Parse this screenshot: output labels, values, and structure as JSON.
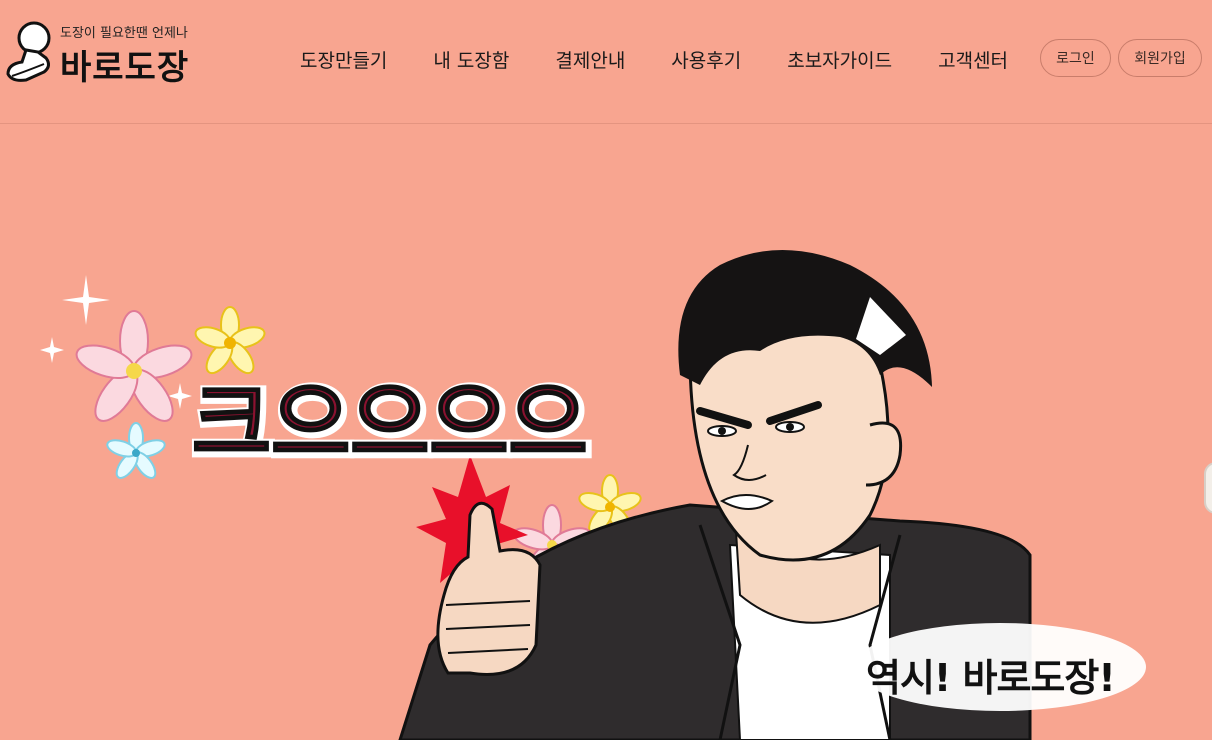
{
  "brand": {
    "tagline": "도장이 필요한땐 언제나",
    "name": "바로도장"
  },
  "nav": {
    "items": [
      "도장만들기",
      "내 도장함",
      "결제안내",
      "사용후기",
      "초보자가이드",
      "고객센터"
    ]
  },
  "auth": {
    "login_label": "로그인",
    "signup_label": "회원가입"
  },
  "hero": {
    "caption": "역시! 바로도장!",
    "title_art": "크으으으으",
    "background_color": "#f8a590",
    "accent_color": "#8b1230"
  }
}
